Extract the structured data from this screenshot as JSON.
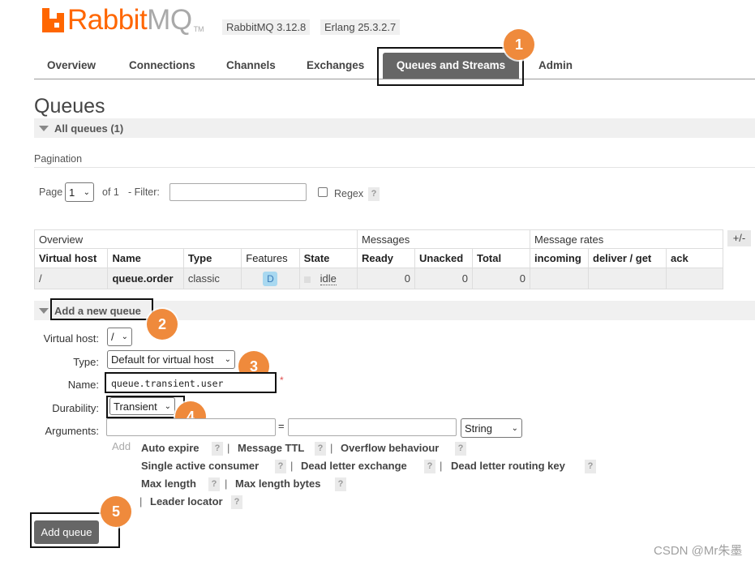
{
  "header": {
    "logo_main": "Rabbit",
    "logo_mq": "MQ",
    "logo_tm": "TM",
    "rabbitmq_version": "RabbitMQ 3.12.8",
    "erlang_version": "Erlang 25.3.2.7"
  },
  "nav": {
    "tabs": [
      "Overview",
      "Connections",
      "Channels",
      "Exchanges",
      "Queues and Streams",
      "Admin"
    ],
    "active": "Queues and Streams"
  },
  "page": {
    "title": "Queues",
    "all_queues": "All queues (1)"
  },
  "pagination": {
    "label": "Pagination",
    "page_label": "Page",
    "page_value": "1",
    "of_label": "of 1",
    "filter_label": "- Filter:",
    "filter_value": "",
    "regex_label": "Regex",
    "help": "?"
  },
  "table": {
    "groups": [
      "Overview",
      "Messages",
      "Message rates"
    ],
    "columns": [
      "Virtual host",
      "Name",
      "Type",
      "Features",
      "State",
      "Ready",
      "Unacked",
      "Total",
      "incoming",
      "deliver / get",
      "ack"
    ],
    "toggle": "+/-",
    "rows": [
      {
        "vhost": "/",
        "name": "queue.order",
        "type": "classic",
        "feature": "D",
        "state": "idle",
        "ready": "0",
        "unacked": "0",
        "total": "0",
        "incoming": "",
        "deliver_get": "",
        "ack": ""
      }
    ]
  },
  "add_queue": {
    "section_title": "Add a new queue",
    "virtual_host_label": "Virtual host:",
    "virtual_host_value": "/",
    "type_label": "Type:",
    "type_value": "Default for virtual host",
    "name_label": "Name:",
    "name_value": "queue.transient.user",
    "required_mark": "*",
    "durability_label": "Durability:",
    "durability_value": "Transient",
    "arguments_label": "Arguments:",
    "equals": "=",
    "arg_type_value": "String",
    "add_label": "Add",
    "arg_links": {
      "auto_expire": "Auto expire",
      "message_ttl": "Message TTL",
      "overflow_behaviour": "Overflow behaviour",
      "single_active_consumer": "Single active consumer",
      "dead_letter_exchange": "Dead letter exchange",
      "dead_letter_routing_key": "Dead letter routing key",
      "max_length": "Max length",
      "max_length_bytes": "Max length bytes",
      "leader_locator": "Leader locator"
    },
    "separator": "|",
    "submit": "Add queue"
  },
  "annotations": {
    "step1": "1",
    "step2": "2",
    "step3": "3",
    "step4": "4",
    "step5": "5",
    "color": "#ef8a3c"
  },
  "watermark": "CSDN @Mr朱墨",
  "colors": {
    "brand_orange": "#ff6600",
    "active_tab": "#666666",
    "feature_badge": "#a8d8f0"
  }
}
